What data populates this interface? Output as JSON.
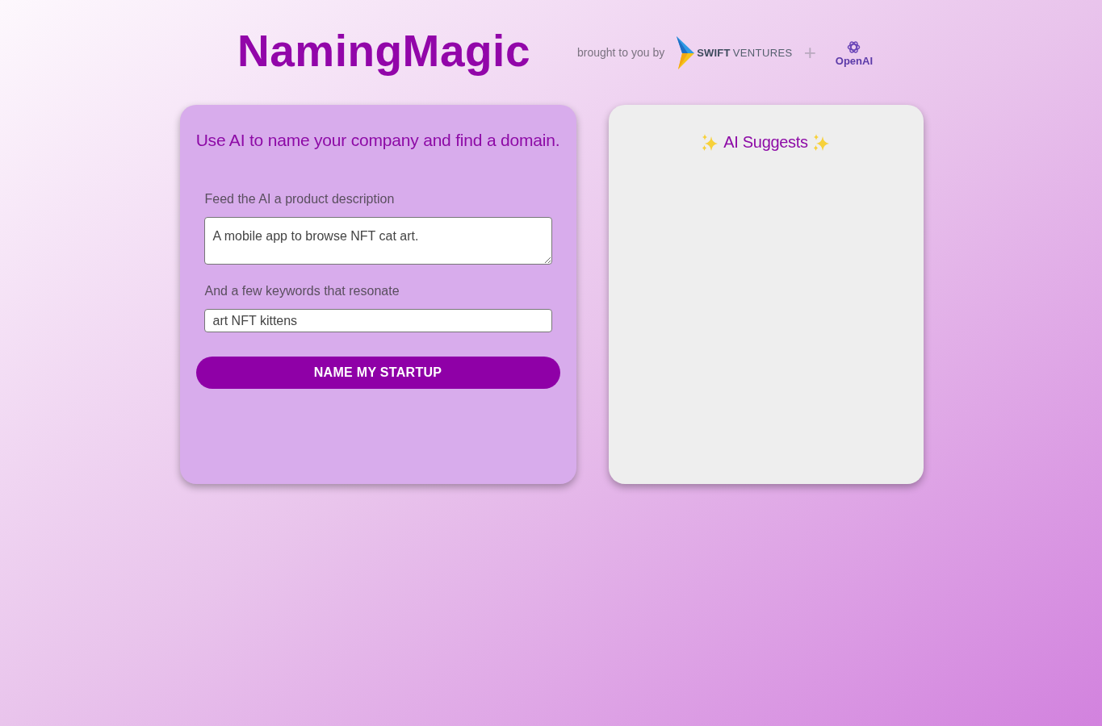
{
  "header": {
    "title": "NamingMagic",
    "tagline": "brought to you by",
    "sponsors": [
      {
        "kind": "swift",
        "name_bold": "SWIFT",
        "name_rest": "VENTURES"
      },
      {
        "kind": "openai",
        "name": "OpenAI"
      }
    ],
    "separator": "+"
  },
  "form": {
    "heading": "Use AI to name your company and find a domain.",
    "fields": [
      {
        "kind": "textarea",
        "label": "Feed the AI a product description",
        "value": "A mobile app to browse NFT cat art."
      },
      {
        "kind": "input",
        "label": "And a few keywords that resonate",
        "value": "art NFT kittens"
      }
    ],
    "submit": "NAME MY STARTUP"
  },
  "suggestions": {
    "title": "AI Suggests"
  }
}
